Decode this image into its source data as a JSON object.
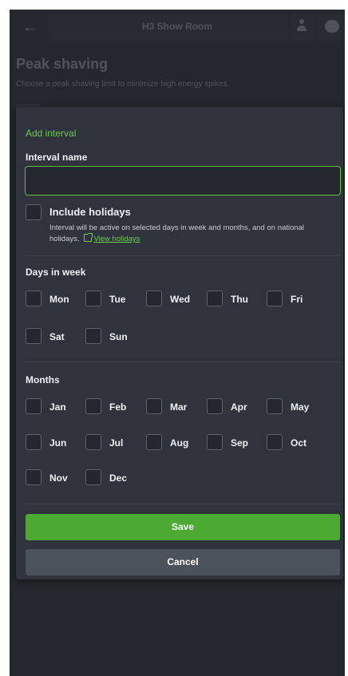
{
  "app": {
    "back_icon": "arrow-left-icon",
    "title": "H3 Show Room",
    "user_icon": "user-icon",
    "chat_icon": "chat-icon"
  },
  "page": {
    "heading": "Peak shaving",
    "subtitle": "Choose a peak shaving limit to minimize high energy spikes."
  },
  "modal": {
    "title": "Add interval",
    "interval_name_label": "Interval name",
    "interval_name_value": "",
    "include_holidays": {
      "label": "Include holidays",
      "description": "Interval will be active on selected days in week and months, and on national holidays.",
      "link_icon": "external-link-icon",
      "link_text": "View holidays",
      "checked": false
    },
    "days_title": "Days in week",
    "days": [
      {
        "label": "Mon",
        "checked": false
      },
      {
        "label": "Tue",
        "checked": false
      },
      {
        "label": "Wed",
        "checked": false
      },
      {
        "label": "Thu",
        "checked": false
      },
      {
        "label": "Fri",
        "checked": false
      },
      {
        "label": "Sat",
        "checked": false
      },
      {
        "label": "Sun",
        "checked": false
      }
    ],
    "months_title": "Months",
    "months": [
      {
        "label": "Jan",
        "checked": false
      },
      {
        "label": "Feb",
        "checked": false
      },
      {
        "label": "Mar",
        "checked": false
      },
      {
        "label": "Apr",
        "checked": false
      },
      {
        "label": "May",
        "checked": false
      },
      {
        "label": "Jun",
        "checked": false
      },
      {
        "label": "Jul",
        "checked": false
      },
      {
        "label": "Aug",
        "checked": false
      },
      {
        "label": "Sep",
        "checked": false
      },
      {
        "label": "Oct",
        "checked": false
      },
      {
        "label": "Nov",
        "checked": false
      },
      {
        "label": "Dec",
        "checked": false
      }
    ],
    "save_label": "Save",
    "cancel_label": "Cancel"
  },
  "colors": {
    "accent_green": "#6ccd4f",
    "save_button": "#4caa32",
    "modal_bg": "#2f333b",
    "page_bg": "#24272d"
  }
}
